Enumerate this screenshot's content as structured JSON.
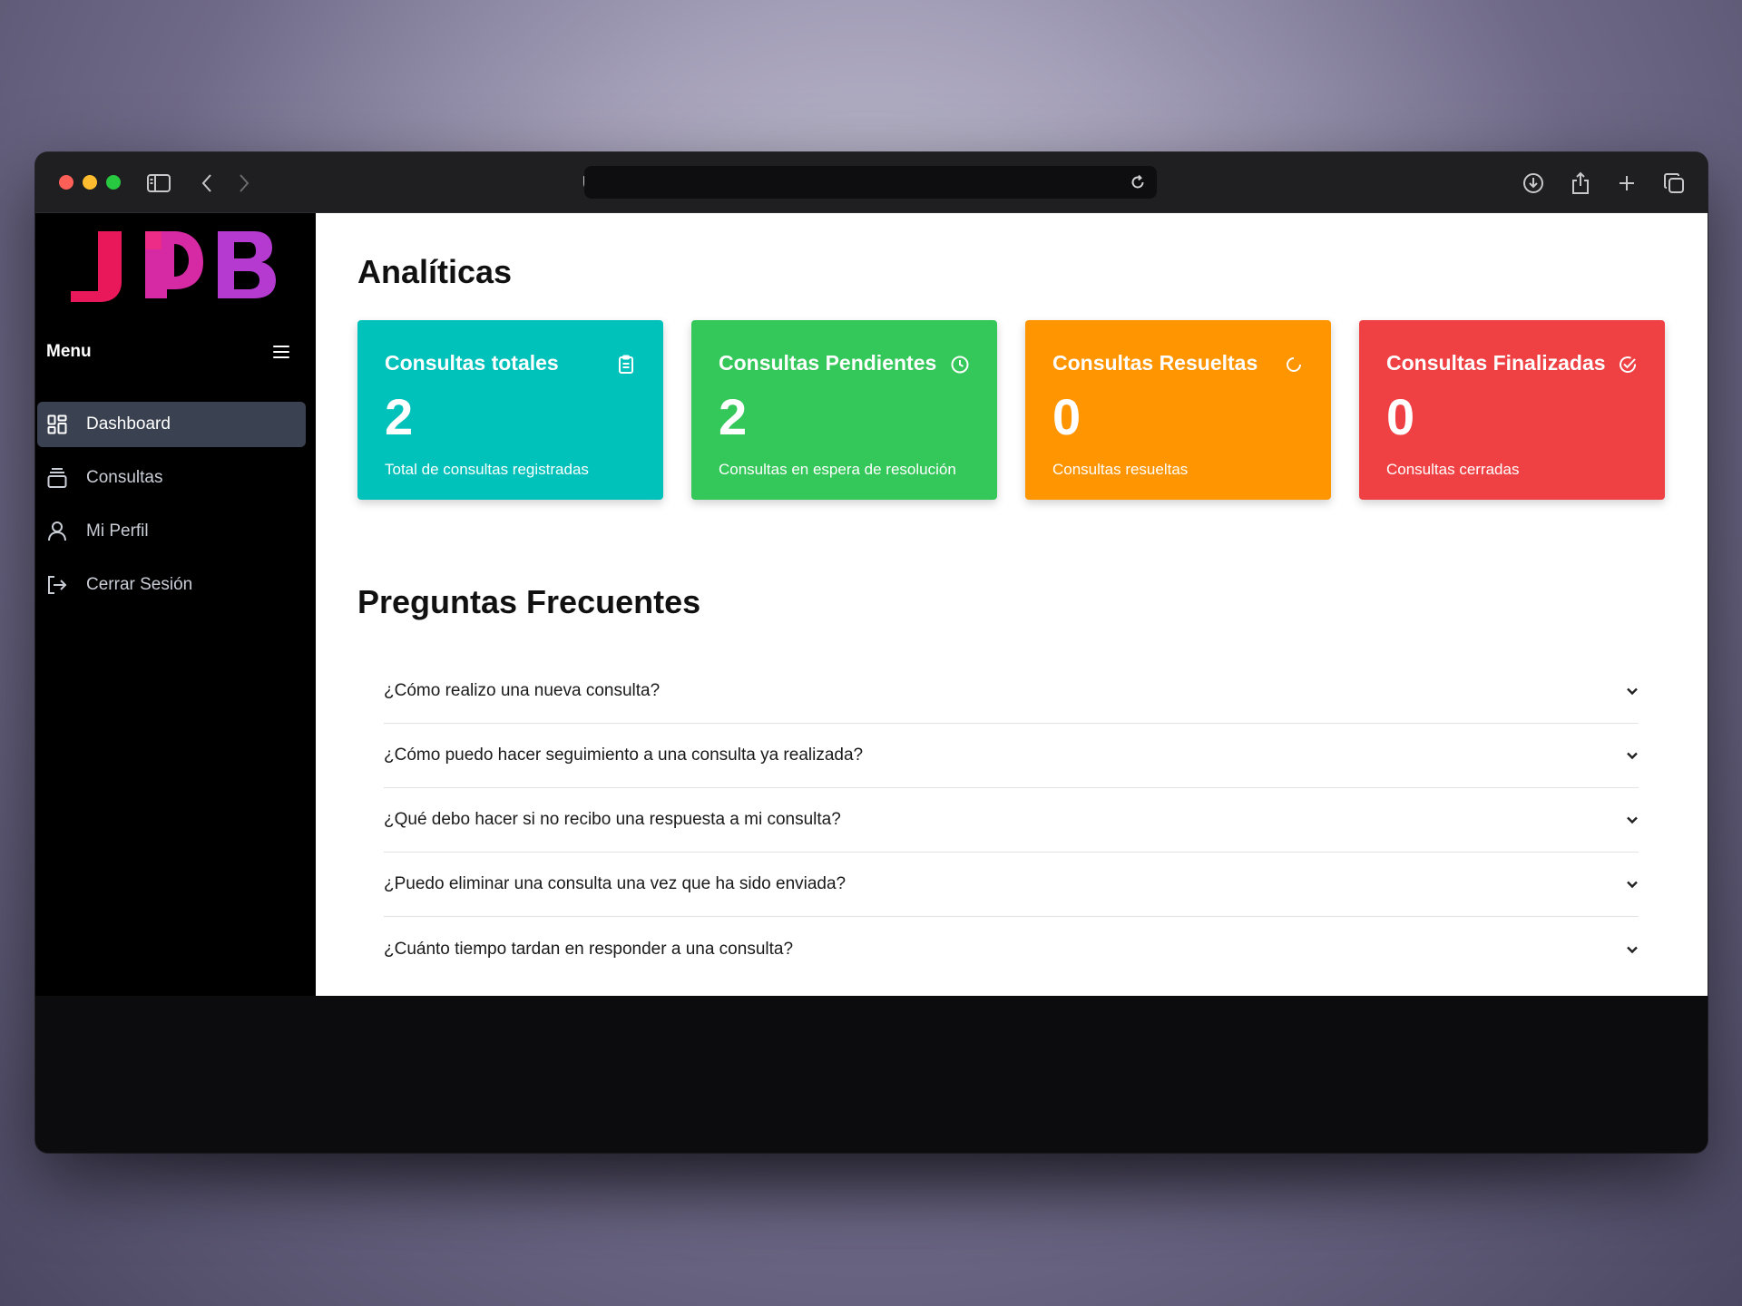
{
  "sidebar": {
    "logo_text": "UDB",
    "menu_label": "Menu",
    "items": [
      {
        "label": "Dashboard",
        "icon": "dashboard-grid-icon",
        "active": true
      },
      {
        "label": "Consultas",
        "icon": "stack-icon",
        "active": false
      },
      {
        "label": "Mi Perfil",
        "icon": "user-icon",
        "active": false
      },
      {
        "label": "Cerrar Sesión",
        "icon": "logout-icon",
        "active": false
      }
    ]
  },
  "main": {
    "analytics_title": "Analíticas",
    "cards": [
      {
        "title": "Consultas totales",
        "value": "2",
        "description": "Total de consultas registradas",
        "icon": "clipboard-icon",
        "color": "#00c2bb"
      },
      {
        "title": "Consultas Pendientes",
        "value": "2",
        "description": "Consultas en espera de resolución",
        "icon": "clock-icon",
        "color": "#34c759"
      },
      {
        "title": "Consultas Resueltas",
        "value": "0",
        "description": "Consultas resueltas",
        "icon": "spinner-icon",
        "color": "#ff9500"
      },
      {
        "title": "Consultas Finalizadas",
        "value": "0",
        "description": "Consultas cerradas",
        "icon": "check-circle-icon",
        "color": "#ef4044"
      }
    ],
    "faq_title": "Preguntas Frecuentes",
    "faq": [
      "¿Cómo realizo una nueva consulta?",
      "¿Cómo puedo hacer seguimiento a una consulta ya realizada?",
      "¿Qué debo hacer si no recibo una respuesta a mi consulta?",
      "¿Puedo eliminar una consulta una vez que ha sido enviada?",
      "¿Cuánto tiempo tardan en responder a una consulta?"
    ]
  },
  "colors": {
    "sidebar_bg": "#000000",
    "active_item_bg": "#3a4150",
    "logo_u": "#e8185a",
    "logo_d": "#d62aa4",
    "logo_b": "#b43ad0"
  }
}
